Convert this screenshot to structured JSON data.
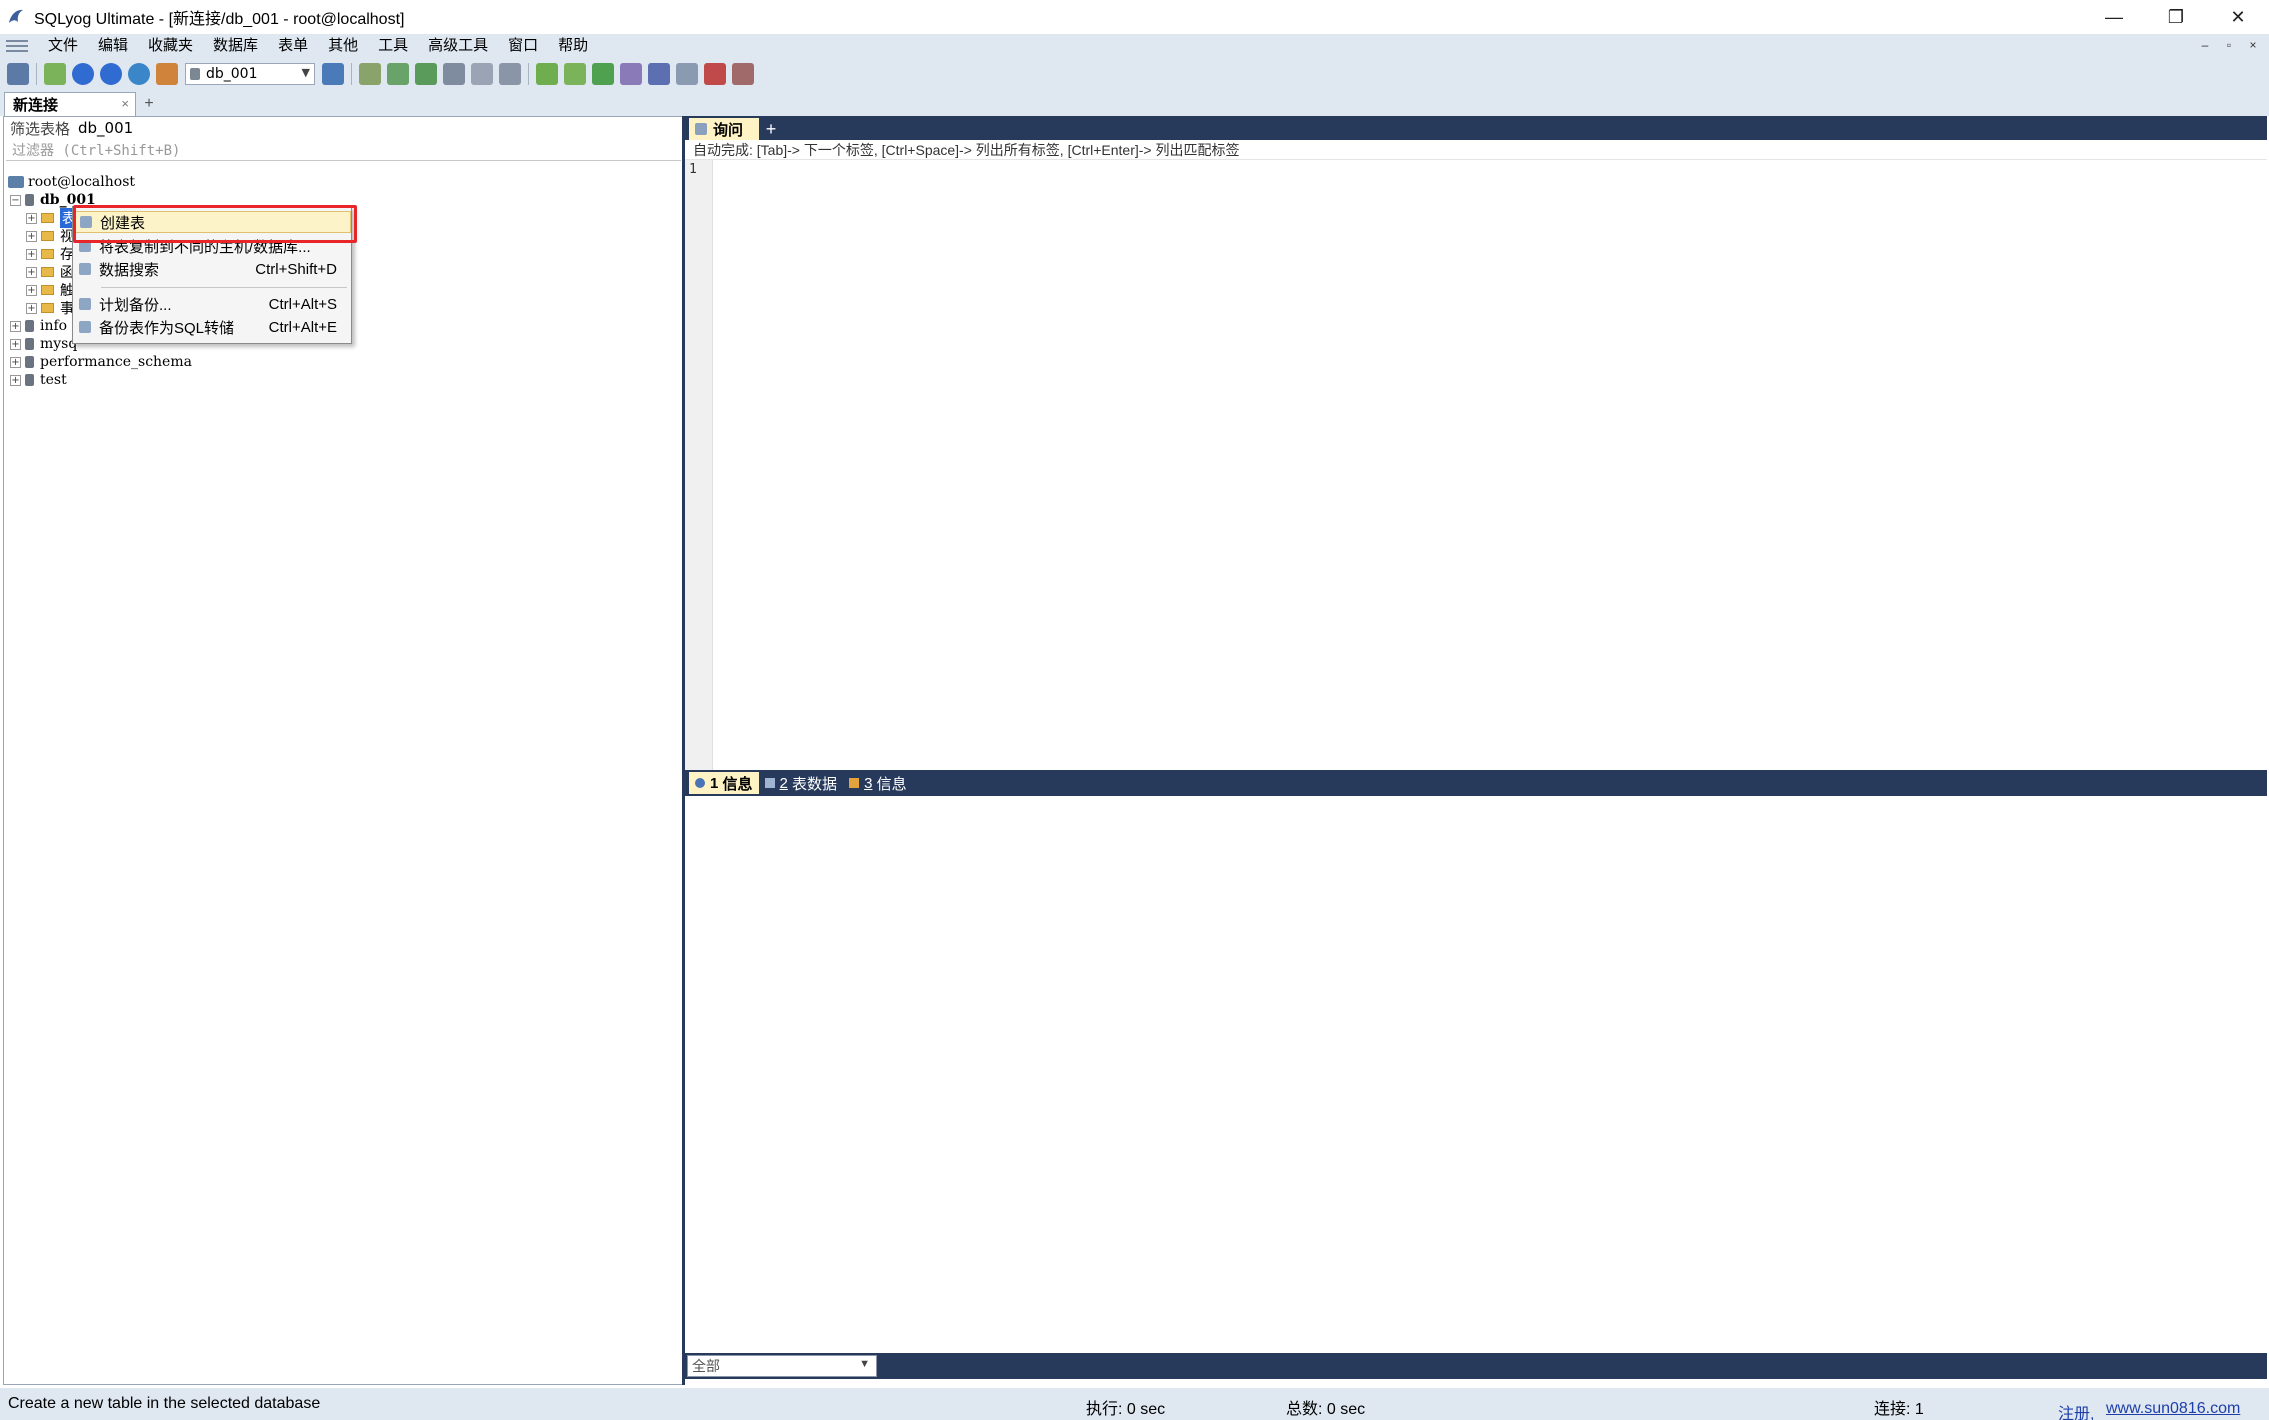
{
  "window": {
    "title": "SQLyog Ultimate - [新连接/db_001 - root@localhost]",
    "minimize": "—",
    "restore": "❐",
    "close": "✕"
  },
  "menu": {
    "items": [
      "文件",
      "编辑",
      "收藏夹",
      "数据库",
      "表单",
      "其他",
      "工具",
      "高级工具",
      "窗口",
      "帮助"
    ],
    "mdi": [
      "–",
      "▫",
      "×"
    ]
  },
  "toolbar": {
    "db_select": "db_001"
  },
  "connection_tab": {
    "label": "新连接",
    "close": "×",
    "add": "+"
  },
  "object_browser": {
    "filter_label": "筛选表格",
    "filter_db": "db_001",
    "filter_placeholder": "过滤器 (Ctrl+Shift+B)",
    "server": "root@localhost",
    "databases": [
      "db_001",
      "info",
      "mysq",
      "performance_schema",
      "test"
    ],
    "folders_truncated": [
      "表",
      "视",
      "存",
      "函",
      "触",
      "事"
    ]
  },
  "context_menu": {
    "items": [
      {
        "label": "创建表",
        "shortcut": ""
      },
      {
        "label": "将表复制到不同的主机/数据库...",
        "shortcut": ""
      },
      {
        "label": "数据搜索",
        "shortcut": "Ctrl+Shift+D"
      },
      {
        "label": "计划备份...",
        "shortcut": "Ctrl+Alt+S"
      },
      {
        "label": "备份表作为SQL转储",
        "shortcut": "Ctrl+Alt+E"
      }
    ]
  },
  "query": {
    "tab_label": "询问",
    "add": "+",
    "autocomplete": "自动完成:  [Tab]-> 下一个标签,  [Ctrl+Space]-> 列出所有标签,  [Ctrl+Enter]-> 列出匹配标签",
    "line_number": "1"
  },
  "results": {
    "tabs": [
      {
        "num": "1",
        "label": "信息"
      },
      {
        "num": "2",
        "label": "表数据"
      },
      {
        "num": "3",
        "label": "信息"
      }
    ],
    "filter": "全部"
  },
  "status": {
    "message": "Create a new table in the selected database",
    "exec": "执行: 0 sec",
    "total": "总数: 0 sec",
    "connections": "连接: 1",
    "register": "注册,",
    "site": "www.sun0816.com"
  },
  "colors": {
    "chrome": "#dfe7f1",
    "navy": "#273a5c",
    "tab_active": "#fff3c6",
    "highlight_box": "#e8262a"
  }
}
